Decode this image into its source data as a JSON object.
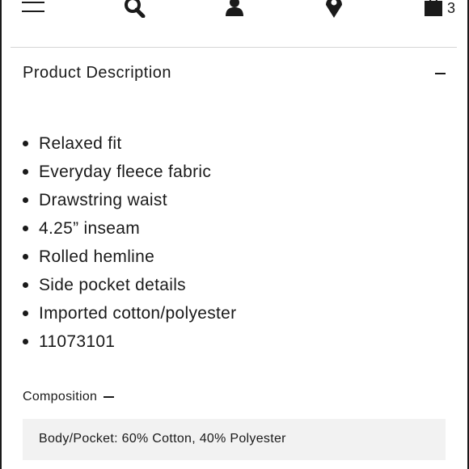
{
  "nav": {
    "icons": [
      "menu-icon",
      "search-icon",
      "account-icon",
      "store-locator-icon",
      "shopping-bag-icon"
    ],
    "bag_count": "3"
  },
  "section": {
    "title": "Product Description",
    "toggle_icon": "minus-icon"
  },
  "details": [
    "Relaxed fit",
    "Everyday fleece fabric",
    "Drawstring waist",
    "4.25” inseam",
    "Rolled hemline",
    "Side pocket details",
    "Imported cotton/polyester",
    "11073101"
  ],
  "composition": {
    "label": "Composition",
    "toggle_icon": "minus-icon",
    "value": "Body/Pocket: 60% Cotton, 40% Polyester"
  },
  "colors": {
    "text": "#1a1a1a",
    "divider": "#d6d6d6",
    "panel_background": "#f2f2f2"
  }
}
